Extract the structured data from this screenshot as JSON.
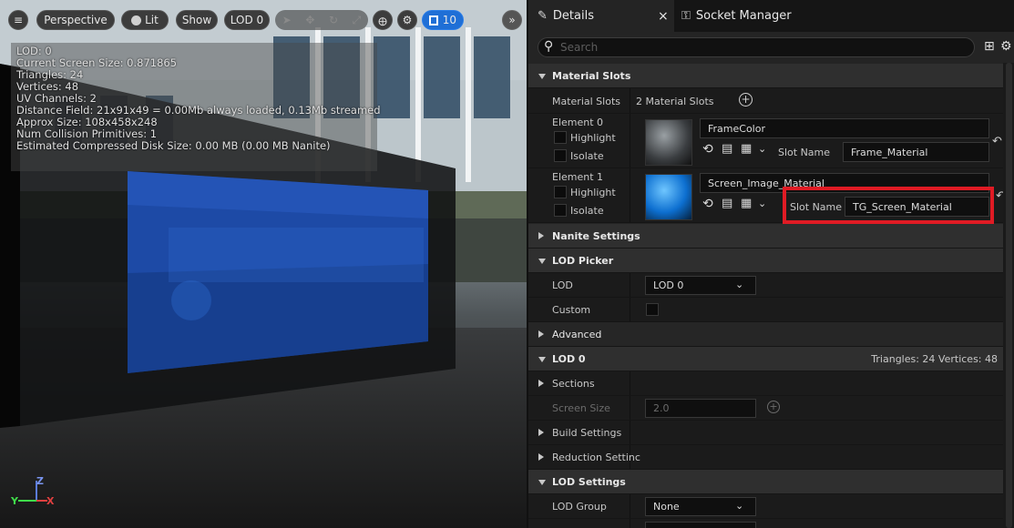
{
  "viewport": {
    "menu_icon": "hamburger-icon",
    "perspective_label": "Perspective",
    "lit_label": "Lit",
    "show_label": "Show",
    "lod_label": "LOD 0",
    "grid_value": "10",
    "stats": [
      "LOD: 0",
      "Current Screen Size: 0.871865",
      "Triangles: 24",
      "Vertices: 48",
      "UV Channels: 2",
      "Distance Field: 21x91x49 = 0.00Mb always loaded, 0.13Mb streamed",
      "Approx Size: 108x458x248",
      "Num Collision Primitives: 1",
      "Estimated Compressed Disk Size: 0.00 MB (0.00 MB Nanite)"
    ],
    "axis_z": "Z",
    "axis_y": "Y",
    "axis_x": "X"
  },
  "tabs": {
    "details": "Details",
    "close": "×",
    "socket_manager": "Socket Manager"
  },
  "search": {
    "placeholder": "Search"
  },
  "details": {
    "material_slots_header": "Material Slots",
    "material_slots_label": "Material Slots",
    "material_slots_value": "2 Material Slots",
    "element0_label": "Element 0",
    "element0_highlight": "Highlight",
    "element0_isolate": "Isolate",
    "element0_material": "FrameColor",
    "element0_slotname_label": "Slot Name",
    "element0_slotname": "Frame_Material",
    "element1_label": "Element 1",
    "element1_highlight": "Highlight",
    "element1_isolate": "Isolate",
    "element1_material": "Screen_Image_Material",
    "element1_slotname_label": "Slot Name",
    "element1_slotname": "TG_Screen_Material",
    "nanite_settings": "Nanite Settings",
    "lod_picker_header": "LOD Picker",
    "lod_label": "LOD",
    "lod_value": "LOD 0",
    "custom_label": "Custom",
    "advanced": "Advanced",
    "lod0_header": "LOD 0",
    "lod0_stats": "Triangles: 24  Vertices: 48",
    "sections": "Sections",
    "screen_size_label": "Screen Size",
    "screen_size_value": "2.0",
    "build_settings": "Build Settings",
    "reduction_settings": "Reduction Settinc",
    "lod_settings_header": "LOD Settings",
    "lod_group_label": "LOD Group",
    "lod_group_value": "None"
  },
  "colors": {
    "highlight_box": "#e01b24",
    "accent": "#1f6fd6"
  }
}
